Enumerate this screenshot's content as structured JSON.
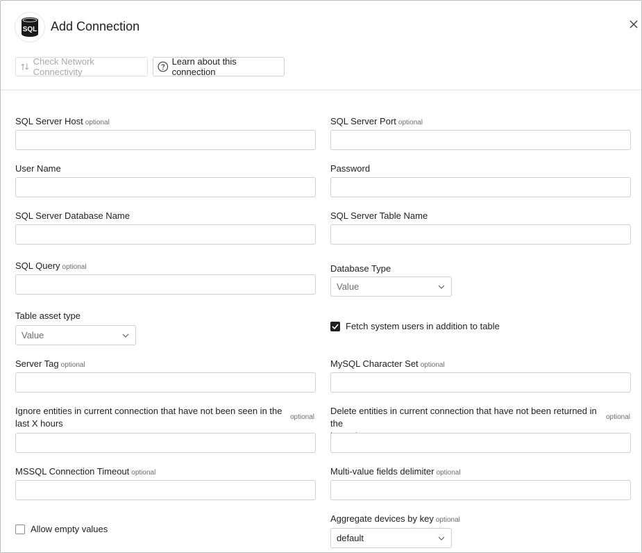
{
  "dialog": {
    "title": "Add Connection",
    "logo_text": "SQL"
  },
  "toolbar": {
    "check_network_label": "Check Network Connectivity",
    "learn_label": "Learn about this connection"
  },
  "optional_text": "optional",
  "fields": {
    "sql_server_host": {
      "label": "SQL Server Host",
      "value": ""
    },
    "sql_server_port": {
      "label": "SQL Server Port",
      "value": ""
    },
    "user_name": {
      "label": "User Name",
      "value": ""
    },
    "password": {
      "label": "Password",
      "value": ""
    },
    "database_name": {
      "label": "SQL Server Database Name",
      "value": ""
    },
    "table_name": {
      "label": "SQL Server Table Name",
      "value": ""
    },
    "sql_query": {
      "label": "SQL Query",
      "value": ""
    },
    "database_type": {
      "label": "Database Type",
      "selected": "Value"
    },
    "table_asset_type": {
      "label": "Table asset type",
      "selected": "Value"
    },
    "fetch_system_users": {
      "label": "Fetch system users in addition to table",
      "checked": true
    },
    "server_tag": {
      "label": "Server Tag",
      "value": ""
    },
    "mysql_charset": {
      "label": "MySQL Character Set",
      "value": ""
    },
    "ignore_entities": {
      "label_line1": "Ignore entities in current connection that have not been seen in the",
      "label_line2": "last X hours",
      "value": ""
    },
    "delete_entities": {
      "label_line1": "Delete entities in current connection that have not been returned in the",
      "label_line2": "last X hours",
      "value": ""
    },
    "mssql_timeout": {
      "label": "MSSQL Connection Timeout",
      "value": ""
    },
    "multi_value_delimiter": {
      "label": "Multi-value fields delimiter",
      "value": ""
    },
    "allow_empty_values": {
      "label": "Allow empty values",
      "checked": false
    },
    "aggregate_devices": {
      "label": "Aggregate devices by key",
      "selected": "default"
    }
  },
  "colors": {
    "border": "#cfcfcf",
    "text": "#212121",
    "muted": "#6b6b6b",
    "checkbox_checked": "#212121"
  }
}
